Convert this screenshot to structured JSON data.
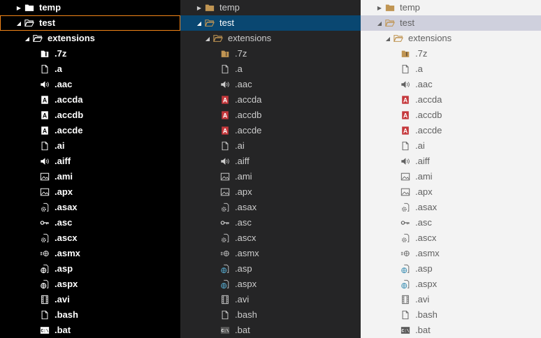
{
  "panels": [
    {
      "theme": "dark-hc",
      "folders": [
        {
          "label": "temp"
        },
        {
          "label": "test"
        },
        {
          "label": "extensions"
        }
      ],
      "files": [
        ".7z",
        ".a",
        ".aac",
        ".accda",
        ".accdb",
        ".accde",
        ".ai",
        ".aiff",
        ".ami",
        ".apx",
        ".asax",
        ".asc",
        ".ascx",
        ".asmx",
        ".asp",
        ".aspx",
        ".avi",
        ".bash",
        ".bat"
      ]
    },
    {
      "theme": "dark",
      "folders": [
        {
          "label": "temp"
        },
        {
          "label": "test"
        },
        {
          "label": "extensions"
        }
      ],
      "files": [
        ".7z",
        ".a",
        ".aac",
        ".accda",
        ".accdb",
        ".accde",
        ".ai",
        ".aiff",
        ".ami",
        ".apx",
        ".asax",
        ".asc",
        ".ascx",
        ".asmx",
        ".asp",
        ".aspx",
        ".avi",
        ".bash",
        ".bat"
      ]
    },
    {
      "theme": "light",
      "folders": [
        {
          "label": "temp"
        },
        {
          "label": "test"
        },
        {
          "label": "extensions"
        }
      ],
      "files": [
        ".7z",
        ".a",
        ".aac",
        ".accda",
        ".accdb",
        ".accde",
        ".ai",
        ".aiff",
        ".ami",
        ".apx",
        ".asax",
        ".asc",
        ".ascx",
        ".asmx",
        ".asp",
        ".aspx",
        ".avi",
        ".bash",
        ".bat"
      ]
    }
  ],
  "icons": {
    ".7z": "archive-icon",
    ".a": "file-icon",
    ".aac": "audio-icon",
    ".accda": "access-icon",
    ".accdb": "access-icon",
    ".accde": "access-icon",
    ".ai": "file-icon",
    ".aiff": "audio-icon",
    ".ami": "image-icon",
    ".apx": "image-icon",
    ".asax": "gear-file-icon",
    ".asc": "key-icon",
    ".ascx": "gear-file-icon",
    ".asmx": "web-service-icon",
    ".asp": "globe-file-icon",
    ".aspx": "globe-file-icon",
    ".avi": "video-icon",
    ".bash": "file-icon",
    ".bat": "terminal-icon"
  },
  "colors": {
    "hc_selection_border": "#f38518",
    "dark_selection": "#094771",
    "light_selection": "#cfd0dd",
    "access_red": "#c5383c",
    "folder_tan": "#c09553",
    "globe_blue": "#519aba"
  }
}
